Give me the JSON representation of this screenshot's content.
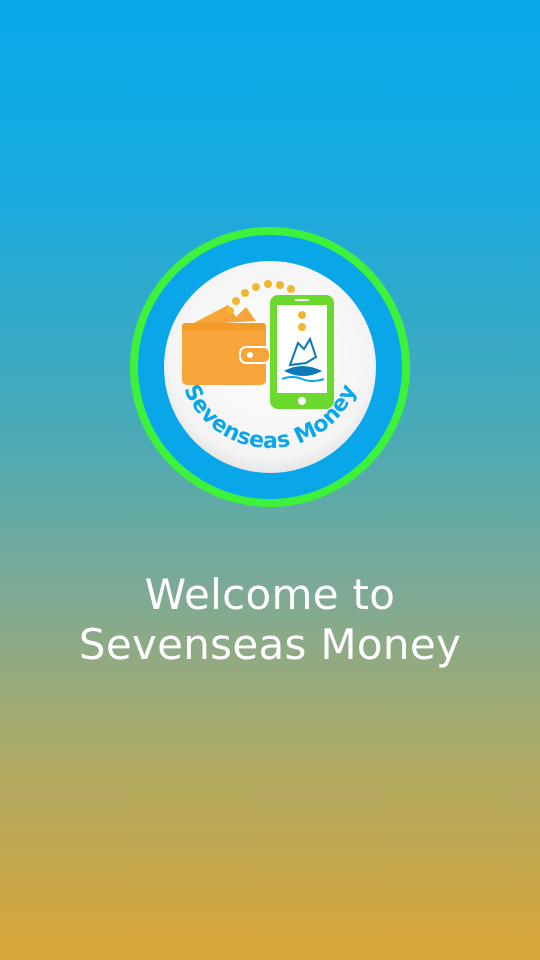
{
  "logo": {
    "brand_text": "Sevenseas Money",
    "ring_color": "#3ef23c",
    "inner_ring_color": "#0aa6ea",
    "wallet_color": "#f7a43a",
    "phone_color": "#6bd92e",
    "coin_color": "#f0b62d",
    "icons": [
      "wallet-icon",
      "smartphone-icon",
      "coin-icon",
      "ship-icon"
    ]
  },
  "welcome": {
    "line1": "Welcome to",
    "line2": "Sevenseas Money"
  },
  "theme": {
    "gradient_top": "#08aaeb",
    "gradient_bottom": "#d9a63a",
    "text_color": "#ffffff"
  }
}
